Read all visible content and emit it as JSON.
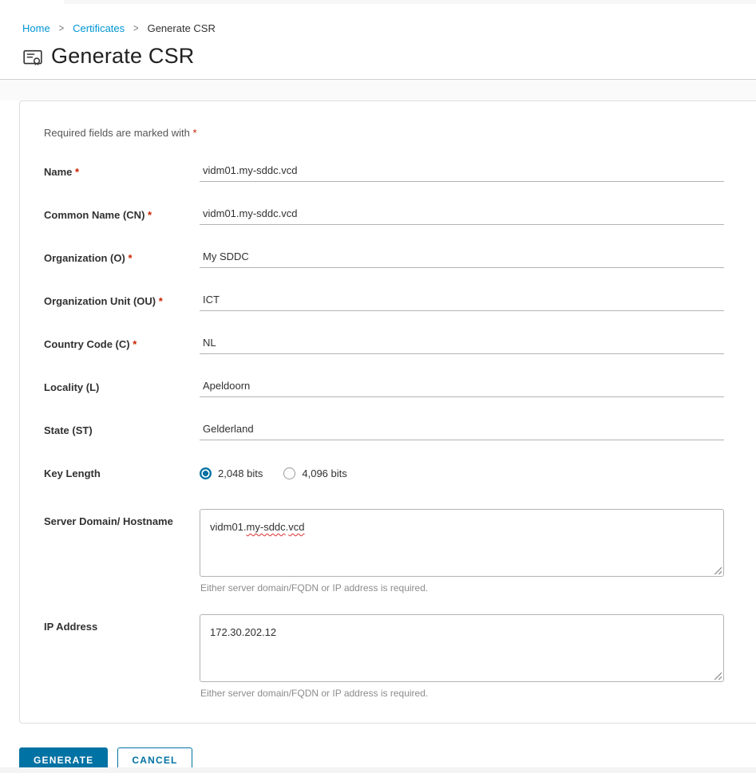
{
  "breadcrumb": {
    "separator": ">",
    "items": [
      {
        "label": "Home"
      },
      {
        "label": "Certificates"
      },
      {
        "label": "Generate CSR"
      }
    ]
  },
  "page": {
    "title": "Generate CSR",
    "icon": "certificate-icon"
  },
  "form": {
    "required_note": "Required fields are marked with",
    "required_marker": "*",
    "fields": [
      {
        "label": "Name",
        "required": true,
        "value": "vidm01.my-sddc.vcd"
      },
      {
        "label": "Common Name (CN)",
        "required": true,
        "value": "vidm01.my-sddc.vcd"
      },
      {
        "label": "Organization (O)",
        "required": true,
        "value": "My SDDC"
      },
      {
        "label": "Organization Unit (OU)",
        "required": true,
        "value": "ICT"
      },
      {
        "label": "Country Code (C)",
        "required": true,
        "value": "NL"
      },
      {
        "label": "Locality (L)",
        "required": false,
        "value": "Apeldoorn"
      },
      {
        "label": "State (ST)",
        "required": false,
        "value": "Gelderland"
      }
    ],
    "key_length": {
      "label": "Key Length",
      "options": [
        {
          "label": "2,048 bits",
          "selected": true
        },
        {
          "label": "4,096 bits",
          "selected": false
        }
      ]
    },
    "server_domain": {
      "label": "Server Domain/ Hostname",
      "value": "vidm01.my-sddc.vcd",
      "segments": [
        {
          "text": "vidm01.",
          "misspelled": false
        },
        {
          "text": "my-sddc",
          "misspelled": true
        },
        {
          "text": ".",
          "misspelled": false
        },
        {
          "text": "vcd",
          "misspelled": true
        }
      ],
      "helper": "Either server domain/FQDN or IP address is required."
    },
    "ip_address": {
      "label": "IP Address",
      "value": "172.30.202.12",
      "helper": "Either server domain/FQDN or IP address is required."
    }
  },
  "actions": {
    "generate_label": "GENERATE",
    "cancel_label": "CANCEL"
  },
  "colors": {
    "primary": "#0072a3",
    "link": "#0095d3",
    "required": "#c92100",
    "card_border": "#dedede",
    "input_border": "#b3b3b3",
    "helper_text": "#8c8c8c"
  }
}
